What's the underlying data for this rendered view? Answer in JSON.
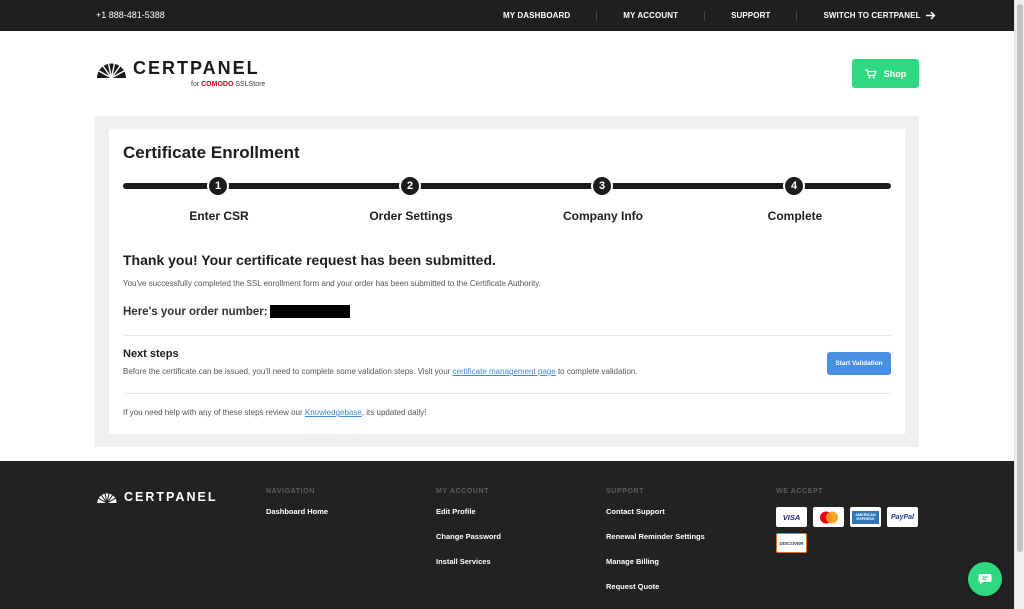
{
  "topbar": {
    "phone": "+1 888-481-5388",
    "nav": [
      "MY DASHBOARD",
      "MY ACCOUNT",
      "SUPPORT",
      "SWITCH TO CERTPANEL"
    ]
  },
  "brand": {
    "name": "CERTPANEL",
    "for_text": "for",
    "partner_name": "COMODO",
    "partner_suffix": "SSLStore"
  },
  "header": {
    "shop_label": "Shop"
  },
  "enrollment": {
    "title": "Certificate Enrollment",
    "steps": [
      {
        "num": "1",
        "label": "Enter CSR"
      },
      {
        "num": "2",
        "label": "Order Settings"
      },
      {
        "num": "3",
        "label": "Company Info"
      },
      {
        "num": "4",
        "label": "Complete"
      }
    ],
    "thanks": "Thank you! Your certificate request has been submitted.",
    "completed_text": "You've successfully completed the SSL enrollment form and your order has been submitted to the Certificate Authority.",
    "order_label": "Here's your order number:",
    "next_steps_title": "Next steps",
    "next_steps_text_before": "Before the certificate can be issued, you'll need to complete some validation steps. Visit your ",
    "next_steps_link": "certificate management page",
    "next_steps_text_after": " to complete validation.",
    "start_validation_label": "Start Validation",
    "help_before": "If you need help with any of these steps review our ",
    "help_link": "Knowledgebase",
    "help_after": ", its updated daily!"
  },
  "footer": {
    "brand": "CERTPANEL",
    "navigation": {
      "heading": "NAVIGATION",
      "links": [
        "Dashboard Home"
      ]
    },
    "my_account": {
      "heading": "MY ACCOUNT",
      "links": [
        "Edit Profile",
        "Change Password",
        "Install Services"
      ]
    },
    "support": {
      "heading": "SUPPORT",
      "links": [
        "Contact Support",
        "Renewal Reminder Settings",
        "Manage Billing",
        "Request Quote"
      ]
    },
    "we_accept": {
      "heading": "WE ACCEPT",
      "cards": [
        "VISA",
        "MasterCard",
        "AMERICAN EXPRESS",
        "PayPal",
        "DISCOVER"
      ]
    }
  },
  "colors": {
    "accent_green": "#2fd982",
    "button_blue": "#4a90e2",
    "link_blue": "#3a8bd8",
    "dark": "#1f1f1f"
  }
}
